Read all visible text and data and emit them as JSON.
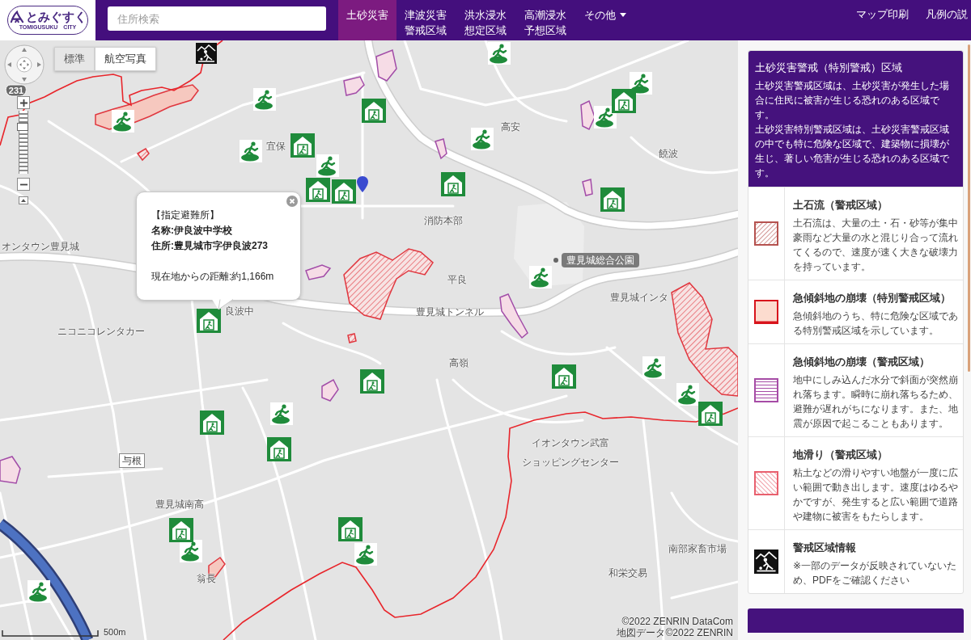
{
  "header": {
    "logo": {
      "name": "とみぐすく",
      "subtitle": "TOMIGUSUKU CITY"
    },
    "search": {
      "placeholder": "住所検索"
    },
    "tabs": [
      {
        "label": "土砂災害",
        "selected": true,
        "menu": false
      },
      {
        "label": "津波災害警戒区域",
        "selected": false,
        "menu": false
      },
      {
        "label": "洪水浸水想定区域",
        "selected": false,
        "menu": false
      },
      {
        "label": "高潮浸水予想区域",
        "selected": false,
        "menu": false
      },
      {
        "label": "その他",
        "selected": false,
        "menu": true
      }
    ],
    "links": [
      "マップ印刷",
      "凡例の説"
    ]
  },
  "map": {
    "map_types": [
      {
        "label": "標準",
        "selected": true
      },
      {
        "label": "航空写真",
        "selected": false
      }
    ],
    "zoom_slider": {
      "level": 0.78
    },
    "labels": [
      {
        "text": "231",
        "kind": "route-shield"
      },
      {
        "text": "高安",
        "kind": "plain"
      },
      {
        "text": "宜保",
        "kind": "plain"
      },
      {
        "text": "饒波",
        "kind": "plain"
      },
      {
        "text": "消防本部",
        "kind": "plain"
      },
      {
        "text": "オンタウン豊見城",
        "kind": "plain"
      },
      {
        "text": "豊見城総合公園",
        "kind": "badge"
      },
      {
        "text": "平良",
        "kind": "plain"
      },
      {
        "text": "豊見城インタ",
        "kind": "plain"
      },
      {
        "text": "良波中",
        "kind": "plain"
      },
      {
        "text": "豊見城トンネル",
        "kind": "plain"
      },
      {
        "text": "ニコニコレンタカー",
        "kind": "plain"
      },
      {
        "text": "高嶺",
        "kind": "plain"
      },
      {
        "text": "イオンタウン武富",
        "kind": "plain"
      },
      {
        "text": "与根",
        "kind": "boxed"
      },
      {
        "text": "ショッピングセンター",
        "kind": "plain"
      },
      {
        "text": "豊見城南高",
        "kind": "plain"
      },
      {
        "text": "南部家畜市場",
        "kind": "plain"
      },
      {
        "text": "翁長",
        "kind": "plain"
      },
      {
        "text": "和栄交易",
        "kind": "plain"
      }
    ],
    "popup": {
      "heading": "【指定避難所】",
      "name": "名称:伊良波中学校",
      "address": "住所:豊見城市字伊良波273",
      "distance": "現在地からの距離:約1,166m"
    },
    "scale": "500m",
    "attribution": [
      "©2022 ZENRIN DataCom",
      "地図データ©2022 ZENRIN"
    ]
  },
  "legend": {
    "title": "土砂災害警戒（特別警戒）区域",
    "description": [
      "土砂災害警戒区域は、土砂災害が発生した場合に住民に被害が生じる恐れのある区域です。",
      "土砂災害特別警戒区域は、土砂災害警戒区域の中でも特に危険な区域で、建築物に損壊が生じ、著しい危害が生じる恐れのある区域です。"
    ],
    "items": [
      {
        "kind": "hatch-right",
        "color": "#b5524f",
        "title": "土石流（警戒区域）",
        "text": "土石流は、大量の土・石・砂等が集中豪雨など大量の水と混じり合って流れてくるので、速度が速く大きな破壊力を持っています。"
      },
      {
        "kind": "filled",
        "color": "#d8141c",
        "title": "急傾斜地の崩壊（特別警戒区域）",
        "text": "急傾斜地のうち、特に危険な区域である特別警戒区域を示しています。"
      },
      {
        "kind": "horizontal-lines",
        "color": "#a64ca6",
        "title": "急傾斜地の崩壊（警戒区域）",
        "text": "地中にしみ込んだ水分で斜面が突然崩れ落ちます。瞬時に崩れ落ちるため、避難が遅れがちになります。また、地震が原因で起こることもあります。"
      },
      {
        "kind": "hatch-left",
        "color": "#e8606e",
        "title": "地滑り（警戒区域）",
        "text": "粘土などの滑りやすい地盤が一度に広い範囲で動き出します。速度はゆるやかですが、発生すると広い範囲で道路や建物に被害をもたらします。"
      },
      {
        "kind": "warning-icon",
        "title": "警戒区域情報",
        "text": "※一部のデータが反映されていないため、PDFをご確認ください"
      }
    ]
  }
}
